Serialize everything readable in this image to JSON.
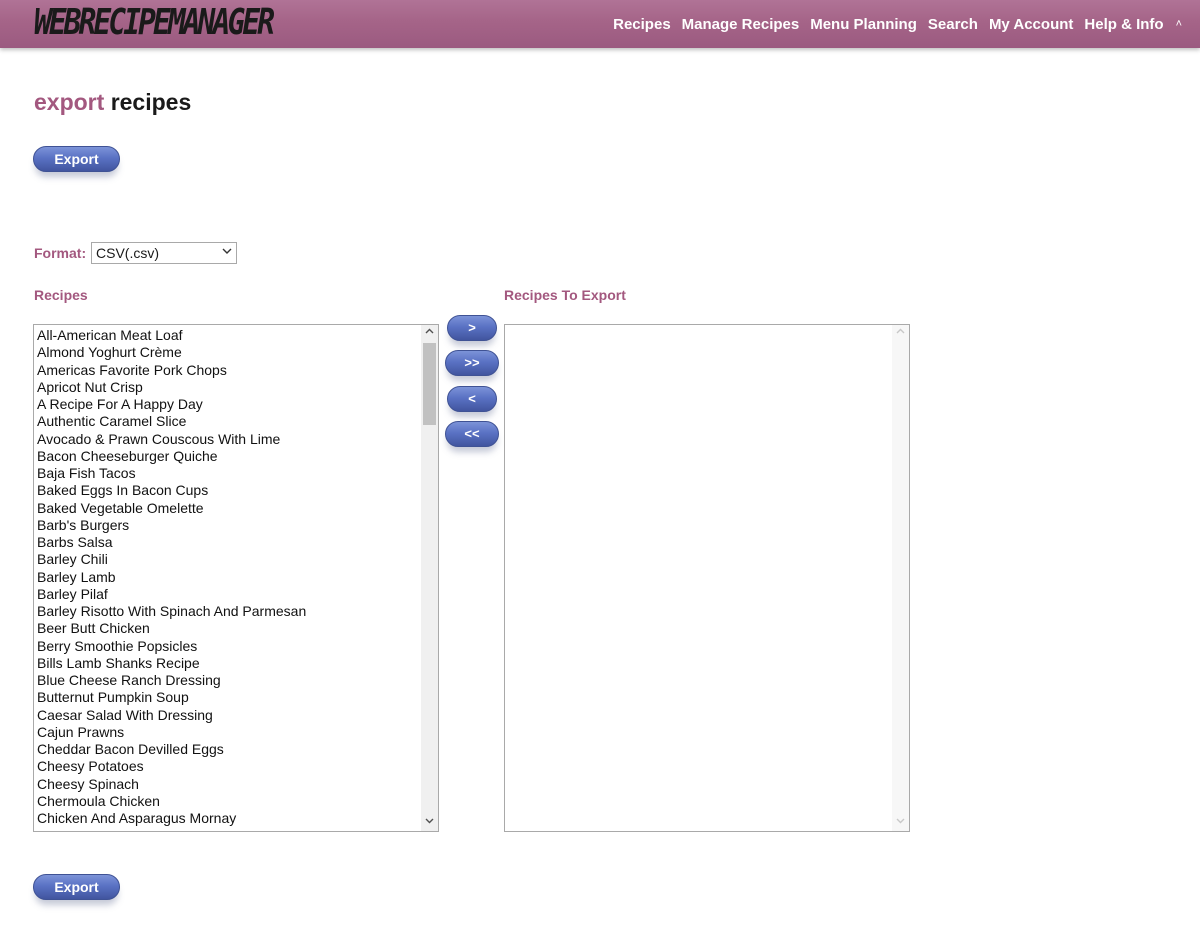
{
  "header": {
    "logo": "WEBRECIPEMANAGER",
    "nav": [
      "Recipes",
      "Manage Recipes",
      "Menu Planning",
      "Search",
      "My Account",
      "Help & Info"
    ],
    "caret": "˄"
  },
  "page": {
    "title_accent": "export",
    "title_rest": "recipes"
  },
  "buttons": {
    "export": "Export",
    "move_one_right": ">",
    "move_all_right": ">>",
    "move_one_left": "<",
    "move_all_left": "<<"
  },
  "format": {
    "label": "Format:",
    "selected": "CSV(.csv)"
  },
  "lists": {
    "recipes_header": "Recipes",
    "export_header": "Recipes To Export",
    "recipes": [
      "All-American Meat Loaf",
      "Almond Yoghurt Crème",
      "Americas Favorite Pork Chops",
      "Apricot Nut Crisp",
      "A Recipe For A Happy Day",
      "Authentic Caramel Slice",
      "Avocado & Prawn Couscous With Lime",
      "Bacon Cheeseburger Quiche",
      "Baja Fish Tacos",
      "Baked Eggs In Bacon Cups",
      "Baked Vegetable Omelette",
      "Barb's Burgers",
      "Barbs Salsa",
      "Barley Chili",
      "Barley Lamb",
      "Barley Pilaf",
      "Barley Risotto With Spinach And Parmesan",
      "Beer Butt Chicken",
      "Berry Smoothie Popsicles",
      "Bills Lamb Shanks Recipe",
      "Blue Cheese Ranch Dressing",
      "Butternut Pumpkin Soup",
      "Caesar Salad With Dressing",
      "Cajun Prawns",
      "Cheddar Bacon Devilled Eggs",
      "Cheesy Potatoes",
      "Cheesy Spinach",
      "Chermoula Chicken",
      "Chicken And Asparagus Mornay"
    ],
    "to_export": []
  },
  "colors": {
    "nav_bar": "#a56488",
    "accent": "#a3587f",
    "button": "#5a72c4"
  }
}
